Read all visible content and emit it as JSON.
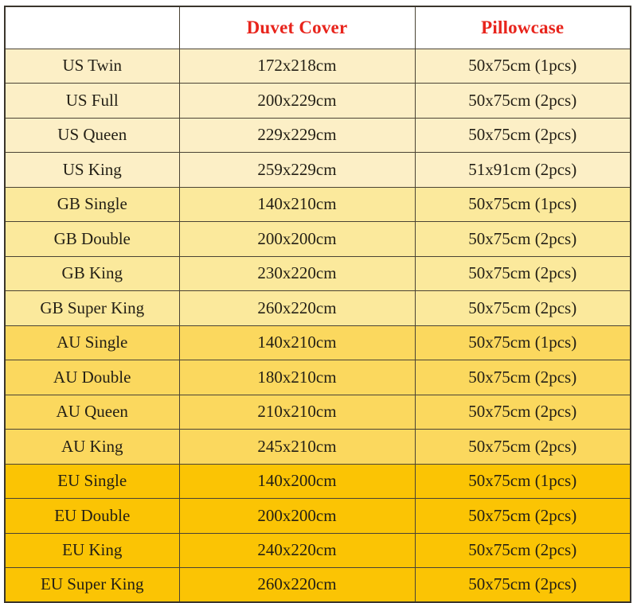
{
  "table": {
    "columns": [
      {
        "key": "size",
        "label": ""
      },
      {
        "key": "duvet",
        "label": "Duvet Cover"
      },
      {
        "key": "pillow",
        "label": "Pillowcase"
      }
    ],
    "colors": {
      "header_text": "#e8241c",
      "highlight_text": "#e8241c",
      "body_text": "#231f15",
      "border": "#4a4334",
      "outer_border": "#3a352c",
      "group_us_bg": "#fcefc6",
      "group_gb_bg": "#fbe99c",
      "group_au_bg": "#fbd85e",
      "group_eu_bg": "#fbc404",
      "header_bg": "#ffffff"
    },
    "rows": [
      {
        "group": "us",
        "size": "US Twin",
        "duvet": "172x218cm",
        "pillow": "50x75cm (1pcs)",
        "pillow_highlight": true
      },
      {
        "group": "us",
        "size": "US Full",
        "duvet": "200x229cm",
        "pillow": "50x75cm (2pcs)",
        "pillow_highlight": false
      },
      {
        "group": "us",
        "size": "US Queen",
        "duvet": "229x229cm",
        "pillow": "50x75cm (2pcs)",
        "pillow_highlight": false
      },
      {
        "group": "us",
        "size": "US King",
        "duvet": "259x229cm",
        "pillow": "51x91cm (2pcs)",
        "pillow_highlight": false
      },
      {
        "group": "gb",
        "size": "GB Single",
        "duvet": "140x210cm",
        "pillow": "50x75cm (1pcs)",
        "pillow_highlight": true
      },
      {
        "group": "gb",
        "size": "GB Double",
        "duvet": "200x200cm",
        "pillow": "50x75cm (2pcs)",
        "pillow_highlight": false
      },
      {
        "group": "gb",
        "size": "GB King",
        "duvet": "230x220cm",
        "pillow": "50x75cm (2pcs)",
        "pillow_highlight": false
      },
      {
        "group": "gb",
        "size": "GB Super King",
        "duvet": "260x220cm",
        "pillow": "50x75cm (2pcs)",
        "pillow_highlight": false
      },
      {
        "group": "au",
        "size": "AU Single",
        "duvet": "140x210cm",
        "pillow": "50x75cm (1pcs)",
        "pillow_highlight": true
      },
      {
        "group": "au",
        "size": "AU Double",
        "duvet": "180x210cm",
        "pillow": "50x75cm (2pcs)",
        "pillow_highlight": false
      },
      {
        "group": "au",
        "size": "AU Queen",
        "duvet": "210x210cm",
        "pillow": "50x75cm (2pcs)",
        "pillow_highlight": false
      },
      {
        "group": "au",
        "size": "AU King",
        "duvet": "245x210cm",
        "pillow": "50x75cm (2pcs)",
        "pillow_highlight": false
      },
      {
        "group": "eu",
        "size": "EU Single",
        "duvet": "140x200cm",
        "pillow": "50x75cm (1pcs)",
        "pillow_highlight": true
      },
      {
        "group": "eu",
        "size": "EU Double",
        "duvet": "200x200cm",
        "pillow": "50x75cm (2pcs)",
        "pillow_highlight": false
      },
      {
        "group": "eu",
        "size": "EU King",
        "duvet": "240x220cm",
        "pillow": "50x75cm (2pcs)",
        "pillow_highlight": false
      },
      {
        "group": "eu",
        "size": "EU Super King",
        "duvet": "260x220cm",
        "pillow": "50x75cm (2pcs)",
        "pillow_highlight": false
      }
    ]
  }
}
